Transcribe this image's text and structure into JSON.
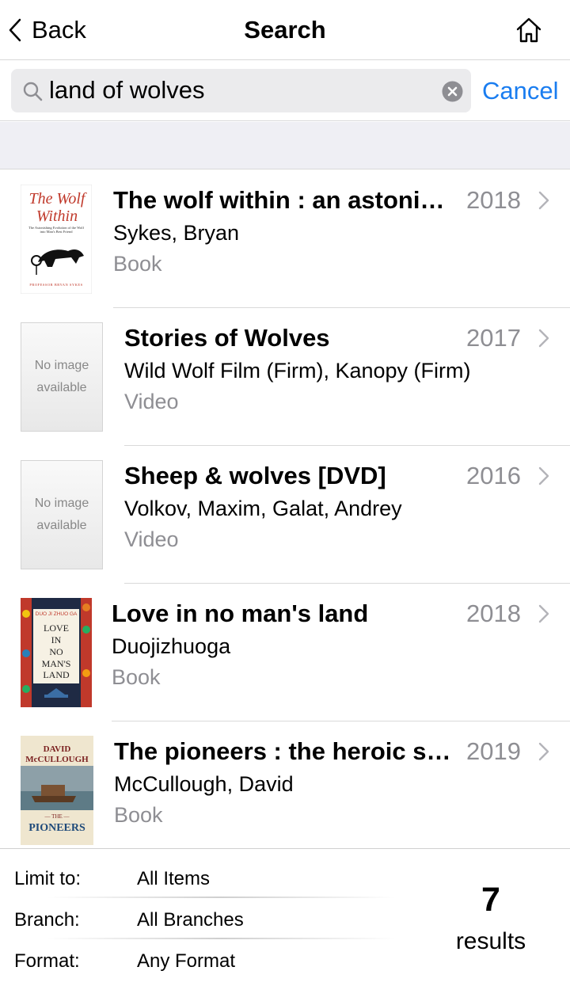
{
  "nav": {
    "back_label": "Back",
    "title": "Search"
  },
  "search": {
    "value": "land of wolves",
    "cancel_label": "Cancel"
  },
  "results": [
    {
      "title": "The wolf within : an astonis...",
      "year": "2018",
      "author": "Sykes, Bryan",
      "format": "Book",
      "cover": {
        "title_line1": "The Wolf",
        "title_line2": "Within",
        "subtitle": "The Astonishing Evolution of the Wolf into Man's Best Friend",
        "author": "PROFESSOR BRYAN SYKES"
      }
    },
    {
      "title": "Stories of Wolves",
      "year": "2017",
      "author": "Wild Wolf Film (Firm), Kanopy (Firm)",
      "format": "Video",
      "cover": {
        "placeholder_line1": "No image",
        "placeholder_line2": "available"
      }
    },
    {
      "title": "Sheep & wolves [DVD]",
      "year": "2016",
      "author": "Volkov, Maxim, Galat, Andrey",
      "format": "Video",
      "cover": {
        "placeholder_line1": "No image",
        "placeholder_line2": "available"
      }
    },
    {
      "title": "Love in no man's land",
      "year": "2018",
      "author": "Duojizhuoga",
      "format": "Book",
      "cover": {
        "author": "DUO JI ZHUO GA",
        "line1": "LOVE",
        "line2": "IN",
        "line3": "NO",
        "line4": "MAN'S",
        "line5": "LAND"
      }
    },
    {
      "title": "The pioneers : the heroic st...",
      "year": "2019",
      "author": "McCullough, David",
      "format": "Book",
      "cover": {
        "author_line1": "DAVID",
        "author_line2": "McCULLOUGH",
        "the": "— THE —",
        "title": "PIONEERS"
      }
    }
  ],
  "filters": {
    "limit_label": "Limit to:",
    "limit_value": "All Items",
    "branch_label": "Branch:",
    "branch_value": "All Branches",
    "format_label": "Format:",
    "format_value": "Any Format"
  },
  "summary": {
    "count": "7",
    "count_label": "results"
  },
  "colors": {
    "accent": "#1a7df0",
    "secondary_text": "#8e8e93",
    "band": "#efeff4"
  }
}
